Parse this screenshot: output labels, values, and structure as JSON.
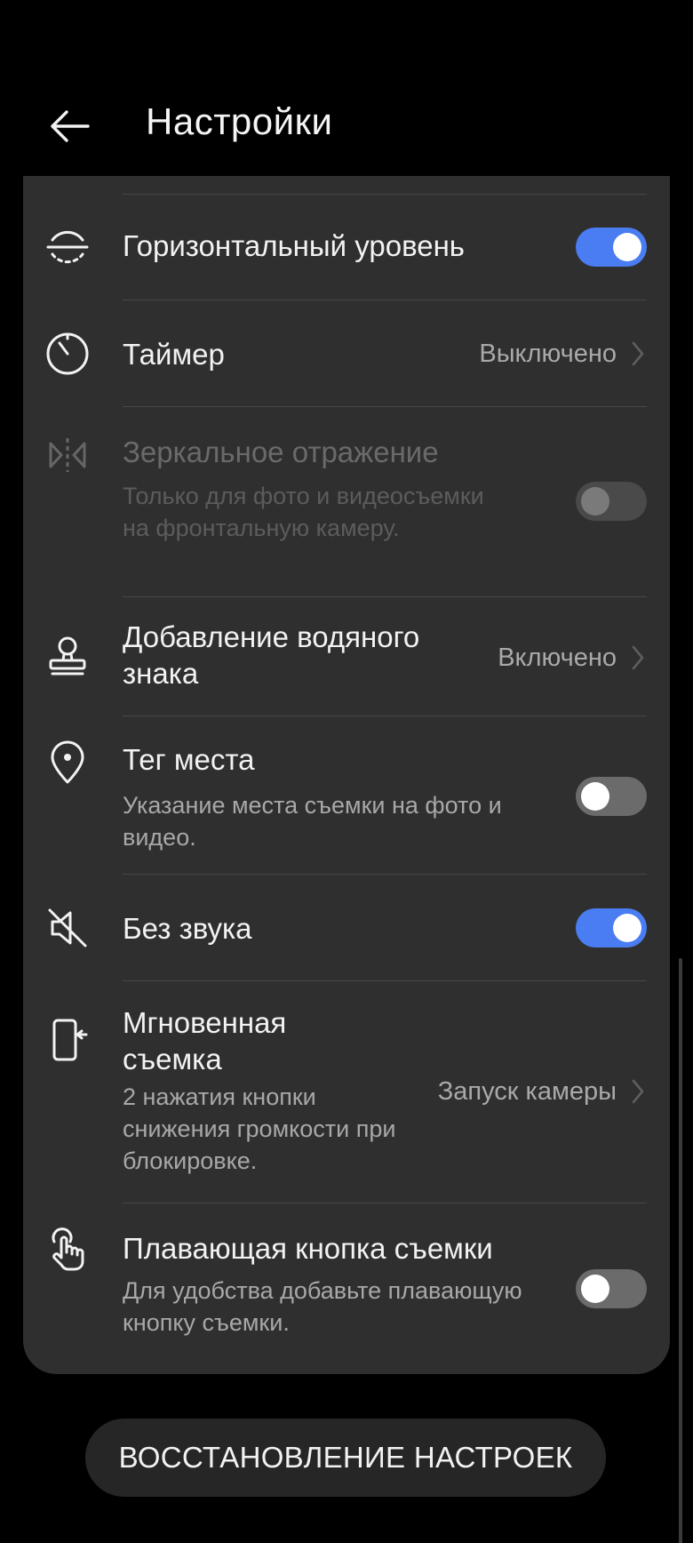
{
  "header": {
    "title": "Настройки",
    "back_icon": "back-arrow-icon"
  },
  "settings": [
    {
      "key": "horizontal_level",
      "icon": "level-circle-icon",
      "title": "Горизонтальный уровень",
      "control": "toggle",
      "state": "on"
    },
    {
      "key": "timer",
      "icon": "timer-icon",
      "title": "Таймер",
      "control": "value",
      "value": "Выключено"
    },
    {
      "key": "mirror",
      "icon": "mirror-icon",
      "title": "Зеркальное отражение",
      "subtitle": "Только для фото и видеосъемки на фронтальную камеру.",
      "control": "toggle",
      "state": "disabled"
    },
    {
      "key": "watermark",
      "icon": "stamp-icon",
      "title": "Добавление водяного знака",
      "control": "value",
      "value": "Включено"
    },
    {
      "key": "location_tag",
      "icon": "location-pin-icon",
      "title": "Тег места",
      "subtitle": "Указание места съемки на фото и видео.",
      "control": "toggle",
      "state": "off"
    },
    {
      "key": "mute",
      "icon": "mute-icon",
      "title": "Без звука",
      "control": "toggle",
      "state": "on"
    },
    {
      "key": "quick_snapshot",
      "icon": "phone-side-button-icon",
      "title": "Мгновенная съемка",
      "subtitle": "2 нажатия кнопки снижения громкости при блокировке.",
      "control": "value",
      "value": "Запуск камеры"
    },
    {
      "key": "floating_shutter",
      "icon": "tap-hand-icon",
      "title": "Плавающая кнопка съемки",
      "subtitle": "Для удобства добавьте плавающую кнопку съемки.",
      "control": "toggle",
      "state": "off"
    }
  ],
  "reset_button": {
    "label": "ВОССТАНОВЛЕНИЕ НАСТРОЕК"
  },
  "colors": {
    "background": "#000000",
    "card": "#2f2f2f",
    "accent": "#4a7cf2",
    "secondary_text": "#a8a8a8"
  }
}
